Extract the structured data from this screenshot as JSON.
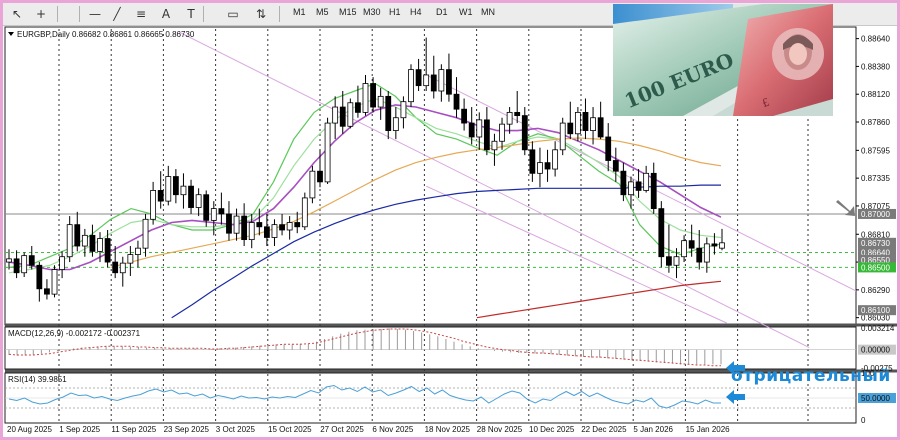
{
  "toolbar": {
    "timeframes": [
      "M1",
      "M5",
      "M15",
      "M30",
      "H1",
      "H4",
      "D1",
      "W1",
      "MN"
    ],
    "tools": [
      "cursor-icon",
      "crosshair-icon",
      "hline-icon",
      "trendline-icon",
      "fibonacci-icon",
      "text-icon",
      "label-icon",
      "rectangle-icon",
      "arrows-icon"
    ]
  },
  "chart_title": "EURGBP,Daily  0.86682 0.86861 0.86665 0.86730",
  "annotation_ru": "отрицательный",
  "banknote": {
    "currency_text": "100 EURO"
  },
  "colors": {
    "up_candle": "#ffffff",
    "down_candle": "#000000",
    "ma_green": "#5cc85c",
    "ma_lightgreen": "#9de09d",
    "ma_violet": "#a64fc1",
    "ma_orange": "#e6a955",
    "ma_navy": "#1b2aa4",
    "ma_red": "#c12b2b",
    "channel": "#d9a6e0",
    "macd_hist": "#9a9a9a",
    "macd_signal": "#cc4444",
    "rsi": "#4aa0d8",
    "arrow_blue": "#1c8ad6",
    "price_tag_gray": "#7a7a7a",
    "price_tag_green": "#38b838"
  },
  "chart_data": {
    "type": "candlestick",
    "title": "EURGBP,Daily  0.86682 0.86861 0.86665 0.86730",
    "symbol": "EURGBP",
    "timeframe": "Daily",
    "ylim": [
      0.8598,
      0.8873
    ],
    "price_ticks": [
      "0.88640",
      "0.88380",
      "0.88120",
      "0.87860",
      "0.87595",
      "0.87335",
      "0.87075",
      "0.86810",
      "0.86550",
      "0.86290",
      "0.86030"
    ],
    "price_labels": [
      {
        "text": "0.87000",
        "price": 0.87,
        "style": "gray"
      },
      {
        "text": "0.86730",
        "price": 0.8673,
        "style": "gray"
      },
      {
        "text": "0.86640",
        "price": 0.8664,
        "style": "gray"
      },
      {
        "text": "0.86550",
        "price": 0.8657,
        "style": "gray"
      },
      {
        "text": "0.86500",
        "price": 0.865,
        "style": "green"
      },
      {
        "text": "0.86100",
        "price": 0.861,
        "style": "gray"
      }
    ],
    "horizontal_levels": [
      {
        "price": 0.87,
        "style": "solid-gray"
      },
      {
        "price": 0.8664,
        "style": "dash-green"
      },
      {
        "price": 0.865,
        "style": "dash-green"
      }
    ],
    "x_labels": [
      "20 Aug 2025",
      "1 Sep 2025",
      "11 Sep 2025",
      "23 Sep 2025",
      "3 Oct 2025",
      "15 Oct 2025",
      "27 Oct 2025",
      "6 Nov 2025",
      "18 Nov 2025",
      "28 Nov 2025",
      "10 Dec 2025",
      "22 Dec 2025",
      "5 Jan 2026",
      "15 Jan 2026"
    ],
    "candles": [
      [
        0.8655,
        0.8667,
        0.8648,
        0.8658
      ],
      [
        0.8658,
        0.8666,
        0.864,
        0.8645
      ],
      [
        0.8645,
        0.8664,
        0.8641,
        0.8661
      ],
      [
        0.8661,
        0.867,
        0.8648,
        0.8652
      ],
      [
        0.8652,
        0.8655,
        0.8618,
        0.863
      ],
      [
        0.863,
        0.8639,
        0.862,
        0.8625
      ],
      [
        0.8625,
        0.8652,
        0.8622,
        0.8648
      ],
      [
        0.8648,
        0.8665,
        0.864,
        0.866
      ],
      [
        0.866,
        0.8698,
        0.8655,
        0.869
      ],
      [
        0.869,
        0.8702,
        0.8665,
        0.867
      ],
      [
        0.867,
        0.8686,
        0.866,
        0.868
      ],
      [
        0.868,
        0.869,
        0.866,
        0.8665
      ],
      [
        0.8665,
        0.8683,
        0.8655,
        0.8677
      ],
      [
        0.8677,
        0.8685,
        0.865,
        0.8655
      ],
      [
        0.8655,
        0.867,
        0.864,
        0.8645
      ],
      [
        0.8645,
        0.866,
        0.8632,
        0.8654
      ],
      [
        0.8654,
        0.867,
        0.8642,
        0.8662
      ],
      [
        0.8662,
        0.8675,
        0.865,
        0.8668
      ],
      [
        0.8668,
        0.87,
        0.866,
        0.8695
      ],
      [
        0.8695,
        0.873,
        0.869,
        0.8722
      ],
      [
        0.8722,
        0.874,
        0.8705,
        0.8712
      ],
      [
        0.8712,
        0.8745,
        0.8708,
        0.8735
      ],
      [
        0.8735,
        0.8742,
        0.871,
        0.8718
      ],
      [
        0.8718,
        0.8738,
        0.8705,
        0.8726
      ],
      [
        0.8726,
        0.8732,
        0.87,
        0.8706
      ],
      [
        0.8706,
        0.8724,
        0.8698,
        0.8718
      ],
      [
        0.8718,
        0.8722,
        0.8688,
        0.8694
      ],
      [
        0.8694,
        0.8712,
        0.868,
        0.8705
      ],
      [
        0.8705,
        0.872,
        0.869,
        0.87
      ],
      [
        0.87,
        0.8712,
        0.8675,
        0.8682
      ],
      [
        0.8682,
        0.8705,
        0.8675,
        0.8698
      ],
      [
        0.8698,
        0.871,
        0.867,
        0.8676
      ],
      [
        0.8676,
        0.87,
        0.8668,
        0.8692
      ],
      [
        0.8692,
        0.8705,
        0.868,
        0.8688
      ],
      [
        0.8688,
        0.87,
        0.867,
        0.8678
      ],
      [
        0.8678,
        0.8695,
        0.867,
        0.869
      ],
      [
        0.869,
        0.87,
        0.868,
        0.8685
      ],
      [
        0.8685,
        0.8698,
        0.8676,
        0.8692
      ],
      [
        0.8692,
        0.8702,
        0.8682,
        0.8688
      ],
      [
        0.8688,
        0.872,
        0.8685,
        0.8715
      ],
      [
        0.8715,
        0.8745,
        0.871,
        0.874
      ],
      [
        0.874,
        0.876,
        0.8725,
        0.873
      ],
      [
        0.873,
        0.879,
        0.8728,
        0.8785
      ],
      [
        0.8785,
        0.881,
        0.877,
        0.88
      ],
      [
        0.88,
        0.8815,
        0.8775,
        0.8782
      ],
      [
        0.8782,
        0.8808,
        0.878,
        0.8804
      ],
      [
        0.8804,
        0.882,
        0.879,
        0.8795
      ],
      [
        0.8795,
        0.883,
        0.8792,
        0.8822
      ],
      [
        0.8822,
        0.8828,
        0.8795,
        0.88
      ],
      [
        0.88,
        0.8818,
        0.8788,
        0.881
      ],
      [
        0.881,
        0.8815,
        0.877,
        0.8778
      ],
      [
        0.8778,
        0.88,
        0.877,
        0.879
      ],
      [
        0.879,
        0.881,
        0.878,
        0.8805
      ],
      [
        0.8805,
        0.884,
        0.88,
        0.8835
      ],
      [
        0.8835,
        0.8845,
        0.8815,
        0.882
      ],
      [
        0.882,
        0.8865,
        0.8815,
        0.883
      ],
      [
        0.883,
        0.8848,
        0.8808,
        0.8815
      ],
      [
        0.8815,
        0.884,
        0.8805,
        0.8835
      ],
      [
        0.8835,
        0.885,
        0.8805,
        0.8812
      ],
      [
        0.8812,
        0.8828,
        0.879,
        0.8798
      ],
      [
        0.8798,
        0.8808,
        0.8778,
        0.8785
      ],
      [
        0.8785,
        0.88,
        0.8765,
        0.8772
      ],
      [
        0.8772,
        0.8795,
        0.876,
        0.8788
      ],
      [
        0.8788,
        0.88,
        0.8755,
        0.876
      ],
      [
        0.876,
        0.8775,
        0.8745,
        0.8768
      ],
      [
        0.8768,
        0.879,
        0.876,
        0.8784
      ],
      [
        0.8784,
        0.88,
        0.8775,
        0.8795
      ],
      [
        0.8795,
        0.8815,
        0.8785,
        0.8792
      ],
      [
        0.8792,
        0.88,
        0.8755,
        0.876
      ],
      [
        0.876,
        0.8768,
        0.873,
        0.8738
      ],
      [
        0.8738,
        0.8762,
        0.8725,
        0.8748
      ],
      [
        0.8748,
        0.876,
        0.873,
        0.8742
      ],
      [
        0.8742,
        0.8768,
        0.8735,
        0.876
      ],
      [
        0.876,
        0.879,
        0.8755,
        0.8785
      ],
      [
        0.8785,
        0.8805,
        0.877,
        0.8775
      ],
      [
        0.8775,
        0.88,
        0.8768,
        0.8795
      ],
      [
        0.8795,
        0.8808,
        0.877,
        0.8778
      ],
      [
        0.8778,
        0.88,
        0.8765,
        0.879
      ],
      [
        0.879,
        0.8805,
        0.877,
        0.8772
      ],
      [
        0.8772,
        0.8785,
        0.874,
        0.875
      ],
      [
        0.875,
        0.8762,
        0.873,
        0.874
      ],
      [
        0.874,
        0.8748,
        0.8712,
        0.8718
      ],
      [
        0.8718,
        0.8735,
        0.8705,
        0.873
      ],
      [
        0.873,
        0.8742,
        0.8715,
        0.8722
      ],
      [
        0.8722,
        0.8745,
        0.872,
        0.8738
      ],
      [
        0.8738,
        0.8748,
        0.87,
        0.8705
      ],
      [
        0.8705,
        0.8712,
        0.865,
        0.866
      ],
      [
        0.866,
        0.869,
        0.8645,
        0.8652
      ],
      [
        0.8652,
        0.8668,
        0.864,
        0.866
      ],
      [
        0.866,
        0.868,
        0.8655,
        0.8675
      ],
      [
        0.8675,
        0.869,
        0.866,
        0.8668
      ],
      [
        0.8668,
        0.8685,
        0.8648,
        0.8655
      ],
      [
        0.8655,
        0.8678,
        0.8645,
        0.8672
      ],
      [
        0.8672,
        0.8682,
        0.8662,
        0.867
      ],
      [
        0.8668,
        0.8686,
        0.8666,
        0.8673
      ]
    ],
    "moving_averages": [
      {
        "color": "#5cc85c",
        "values": [
          0.865,
          0.8652,
          0.866,
          0.8668,
          0.868,
          0.8695,
          0.8705,
          0.87,
          0.869,
          0.8685,
          0.8685,
          0.869,
          0.87,
          0.873,
          0.877,
          0.8795,
          0.8808,
          0.8815,
          0.8822,
          0.881,
          0.879,
          0.8775,
          0.877,
          0.8762,
          0.8755,
          0.8768,
          0.8775,
          0.877,
          0.8755,
          0.874,
          0.8728,
          0.869,
          0.867,
          0.8662,
          0.8668,
          0.8672
        ]
      },
      {
        "color": "#9de09d",
        "values": [
          0.8645,
          0.8648,
          0.8652,
          0.866,
          0.867,
          0.8682,
          0.8692,
          0.8695,
          0.869,
          0.8688,
          0.8688,
          0.869,
          0.8695,
          0.8715,
          0.8745,
          0.877,
          0.8788,
          0.88,
          0.8808,
          0.88,
          0.879,
          0.878,
          0.8775,
          0.8768,
          0.8762,
          0.8768,
          0.8772,
          0.877,
          0.876,
          0.8748,
          0.8735,
          0.8712,
          0.8695,
          0.8685,
          0.868,
          0.8678
        ]
      },
      {
        "color": "#a64fc1",
        "values": [
          0.8655,
          0.8652,
          0.8648,
          0.8648,
          0.8655,
          0.8665,
          0.8675,
          0.8685,
          0.8692,
          0.8694,
          0.8692,
          0.869,
          0.8693,
          0.8705,
          0.8725,
          0.8748,
          0.8768,
          0.8785,
          0.8797,
          0.8802,
          0.88,
          0.8795,
          0.879,
          0.8783,
          0.8778,
          0.8778,
          0.878,
          0.8776,
          0.8768,
          0.876,
          0.875,
          0.874,
          0.873,
          0.8718,
          0.8706,
          0.8697
        ]
      },
      {
        "color": "#e6a955",
        "values": [
          null,
          null,
          null,
          null,
          null,
          0.865,
          0.8655,
          0.866,
          0.8664,
          0.8668,
          0.8672,
          0.8676,
          0.868,
          0.8686,
          0.8693,
          0.8702,
          0.8712,
          0.8722,
          0.8732,
          0.8741,
          0.8748,
          0.8753,
          0.8757,
          0.876,
          0.8762,
          0.8765,
          0.8768,
          0.877,
          0.8771,
          0.877,
          0.8768,
          0.8764,
          0.8759,
          0.8753,
          0.8748,
          0.8745
        ]
      },
      {
        "color": "#1b2aa4",
        "values": [
          null,
          null,
          null,
          null,
          null,
          null,
          null,
          null,
          0.8603,
          0.8615,
          0.8628,
          0.864,
          0.8652,
          0.8663,
          0.8674,
          0.8683,
          0.8691,
          0.8698,
          0.8704,
          0.8709,
          0.8713,
          0.8716,
          0.8719,
          0.8721,
          0.8722,
          0.8723,
          0.8724,
          0.8724,
          0.8724,
          0.8724,
          0.8724,
          0.8725,
          0.8726,
          0.8726,
          0.8727,
          0.8727
        ]
      },
      {
        "color": "#c12b2b",
        "values": [
          null,
          null,
          null,
          null,
          null,
          null,
          null,
          null,
          null,
          null,
          null,
          null,
          null,
          null,
          null,
          null,
          null,
          null,
          null,
          null,
          null,
          null,
          null,
          0.8603,
          0.8606,
          0.8609,
          0.8612,
          0.8615,
          0.8618,
          0.8621,
          0.8624,
          0.8627,
          0.863,
          0.8633,
          0.8635,
          0.8637
        ]
      }
    ],
    "channel_lines": [
      {
        "from": [
          0.205,
          0.887
        ],
        "to": [
          0.945,
          0.8575
        ]
      },
      {
        "from": [
          0.495,
          0.883
        ],
        "to": [
          1.0,
          0.8628
        ]
      },
      {
        "from": [
          0.495,
          0.8726
        ],
        "to": [
          0.848,
          0.8598
        ]
      }
    ],
    "macd": {
      "label": "MACD(12,26,9) -0.002172 -0.002371",
      "ticks": [
        "0.003214",
        "0.00000",
        "-0.00275"
      ],
      "ylim": [
        -0.0029,
        0.0034
      ],
      "histogram": [
        -0.0008,
        -0.0009,
        -0.0009,
        -0.0008,
        -0.0006,
        -0.0004,
        -0.0002,
        0.0,
        0.0002,
        0.0003,
        0.0004,
        0.0005,
        0.0005,
        0.0005,
        0.0005,
        0.0004,
        0.0004,
        0.0003,
        0.0003,
        0.0002,
        0.0002,
        0.0002,
        0.0002,
        0.0002,
        0.0001,
        0.0001,
        0.0002,
        0.0002,
        0.0003,
        0.0004,
        0.0005,
        0.0006,
        0.0007,
        0.0008,
        0.0008,
        0.0008,
        0.0009,
        0.0009,
        0.0012,
        0.0016,
        0.002,
        0.0024,
        0.0027,
        0.0029,
        0.003,
        0.0031,
        0.0031,
        0.0032,
        0.0031,
        0.003,
        0.0028,
        0.0026,
        0.0023,
        0.002,
        0.0016,
        0.0012,
        0.0008,
        0.0005,
        0.0002,
        0.0,
        -0.0002,
        -0.0003,
        -0.0004,
        -0.0005,
        -0.0005,
        -0.0006,
        -0.0006,
        -0.0007,
        -0.0008,
        -0.0009,
        -0.001,
        -0.0011,
        -0.0012,
        -0.0012,
        -0.0013,
        -0.0014,
        -0.0015,
        -0.0016,
        -0.0017,
        -0.0018,
        -0.0019,
        -0.002,
        -0.0021,
        -0.0022,
        -0.0022,
        -0.0022,
        -0.0022,
        -0.0022,
        -0.0022
      ],
      "signal": [
        -0.0007,
        -0.0008,
        -0.0008,
        -0.0008,
        -0.0007,
        -0.0006,
        -0.0004,
        -0.0002,
        0.0,
        0.0002,
        0.0003,
        0.0004,
        0.0005,
        0.0005,
        0.0005,
        0.0005,
        0.0004,
        0.0004,
        0.0003,
        0.0003,
        0.0002,
        0.0002,
        0.0002,
        0.0002,
        0.0002,
        0.0001,
        0.0001,
        0.0002,
        0.0002,
        0.0003,
        0.0004,
        0.0005,
        0.0006,
        0.0007,
        0.0008,
        0.0008,
        0.0008,
        0.0009,
        0.001,
        0.0013,
        0.0016,
        0.0019,
        0.0022,
        0.0025,
        0.0027,
        0.0029,
        0.003,
        0.0031,
        0.0031,
        0.0031,
        0.003,
        0.0028,
        0.0026,
        0.0023,
        0.002,
        0.0017,
        0.0013,
        0.001,
        0.0007,
        0.0004,
        0.0002,
        0.0,
        -0.0001,
        -0.0003,
        -0.0004,
        -0.0005,
        -0.0005,
        -0.0006,
        -0.0007,
        -0.0008,
        -0.0009,
        -0.001,
        -0.0011,
        -0.0011,
        -0.0012,
        -0.0013,
        -0.0014,
        -0.0015,
        -0.0016,
        -0.0017,
        -0.0018,
        -0.0019,
        -0.002,
        -0.0021,
        -0.0022,
        -0.0023,
        -0.0023,
        -0.0024,
        -0.0024
      ]
    },
    "rsi": {
      "label": "RSI(14) 39.9851",
      "ticks": [
        "100",
        "50.0000",
        "0"
      ],
      "ylim": [
        0,
        100
      ],
      "levels": [
        70,
        30
      ],
      "values": [
        48,
        45,
        50,
        42,
        38,
        40,
        47,
        52,
        60,
        55,
        56,
        50,
        53,
        48,
        45,
        50,
        54,
        57,
        64,
        68,
        62,
        66,
        58,
        60,
        54,
        58,
        50,
        55,
        52,
        48,
        54,
        50,
        51,
        48,
        52,
        50,
        53,
        51,
        58,
        65,
        60,
        72,
        75,
        66,
        70,
        63,
        72,
        62,
        66,
        55,
        60,
        66,
        73,
        63,
        70,
        58,
        66,
        55,
        50,
        46,
        44,
        52,
        40,
        49,
        58,
        64,
        60,
        47,
        40,
        48,
        45,
        55,
        63,
        55,
        63,
        53,
        60,
        52,
        45,
        41,
        38,
        46,
        42,
        50,
        34,
        30,
        36,
        44,
        42,
        38,
        46,
        40,
        40
      ]
    }
  }
}
